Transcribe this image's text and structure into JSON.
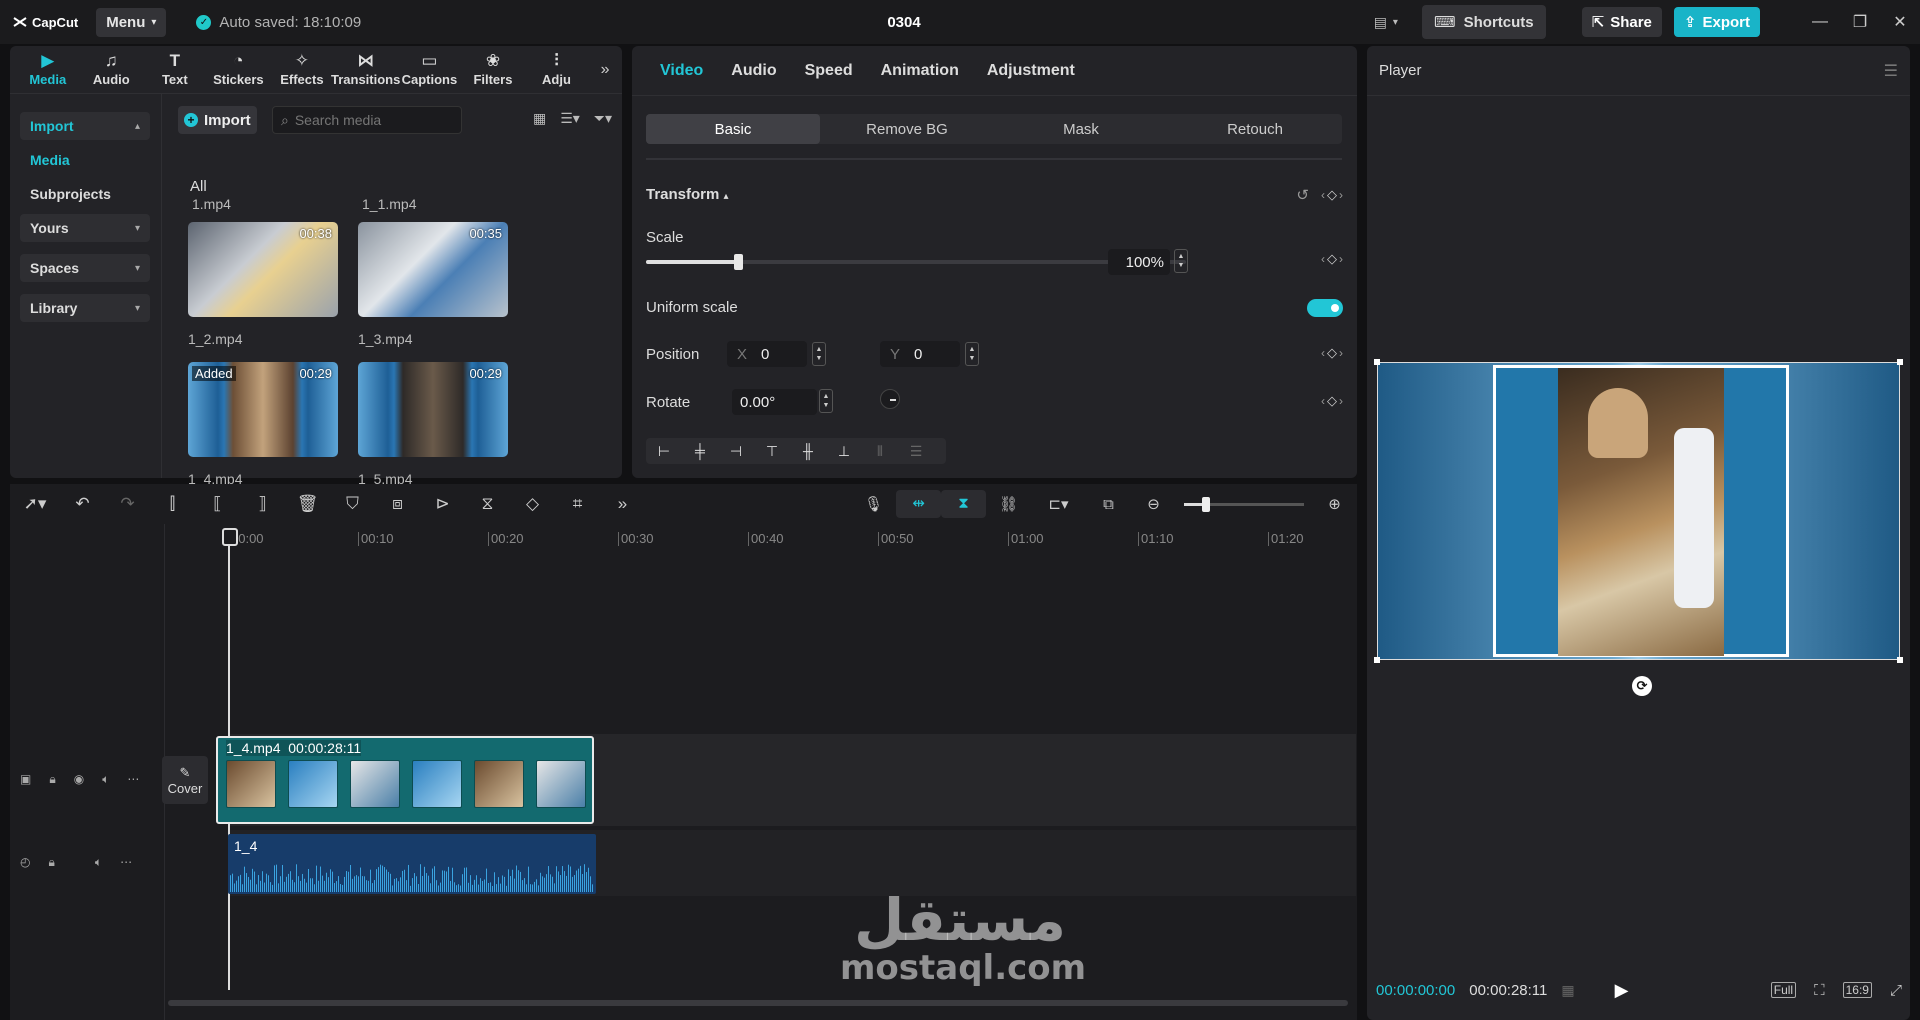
{
  "app": {
    "logo_text": "CapCut",
    "menu_label": "Menu",
    "autosave_text": "Auto saved: 18:10:09",
    "project_title": "0304",
    "shortcuts_label": "Shortcuts",
    "share_label": "Share",
    "export_label": "Export"
  },
  "media_panel": {
    "tabs": [
      {
        "label": "Media",
        "icon": "media-icon",
        "active": true
      },
      {
        "label": "Audio",
        "icon": "audio-icon"
      },
      {
        "label": "Text",
        "icon": "text-icon"
      },
      {
        "label": "Stickers",
        "icon": "stickers-icon"
      },
      {
        "label": "Effects",
        "icon": "effects-icon"
      },
      {
        "label": "Transitions",
        "icon": "transitions-icon"
      },
      {
        "label": "Captions",
        "icon": "captions-icon"
      },
      {
        "label": "Filters",
        "icon": "filters-icon"
      },
      {
        "label": "Adju",
        "icon": "adjustment-icon"
      }
    ],
    "sidebar": {
      "import": "Import",
      "media": "Media",
      "subprojects": "Subprojects",
      "yours": "Yours",
      "spaces": "Spaces",
      "library": "Library"
    },
    "import_button": "Import",
    "search_placeholder": "Search media",
    "all_label": "All",
    "top_files": [
      "1.mp4",
      "1_1.mp4"
    ],
    "items": [
      {
        "name": "1_2.mp4",
        "duration": "00:38",
        "added": ""
      },
      {
        "name": "1_3.mp4",
        "duration": "00:35",
        "added": ""
      },
      {
        "name": "1_4.mp4",
        "duration": "00:29",
        "added": "Added"
      },
      {
        "name": "1_5.mp4",
        "duration": "00:29",
        "added": ""
      }
    ]
  },
  "properties": {
    "tabs": [
      "Video",
      "Audio",
      "Speed",
      "Animation",
      "Adjustment"
    ],
    "active_tab": "Video",
    "segments": [
      "Basic",
      "Remove BG",
      "Mask",
      "Retouch"
    ],
    "active_segment": "Basic",
    "transform_label": "Transform",
    "scale_label": "Scale",
    "scale_value": "100%",
    "scale_fraction": 0.17,
    "uniform_scale_label": "Uniform scale",
    "uniform_scale_on": true,
    "position_label": "Position",
    "pos_x_label": "X",
    "pos_x": "0",
    "pos_y_label": "Y",
    "pos_y": "0",
    "rotate_label": "Rotate",
    "rotate_value": "0.00°"
  },
  "player": {
    "title": "Player",
    "current_time": "00:00:00:00",
    "total_time": "00:00:28:11",
    "full_label": "Full",
    "ratio_label": "16:9"
  },
  "timeline": {
    "ticks": [
      "00:00",
      "00:10",
      "00:20",
      "00:30",
      "00:40",
      "00:50",
      "01:00",
      "01:10",
      "01:20"
    ],
    "cover_label": "Cover",
    "video_clip_label": "1_4.mp4  00:00:28:11",
    "audio_clip_label": "1_4",
    "zoom_fraction": 0.18
  },
  "watermark": {
    "arabic": "مستقل",
    "latin": "mostaql.com"
  },
  "colors": {
    "accent": "#22c6d6",
    "export": "#19b4c8",
    "clip": "#136a6f",
    "audio": "#173c6a"
  }
}
